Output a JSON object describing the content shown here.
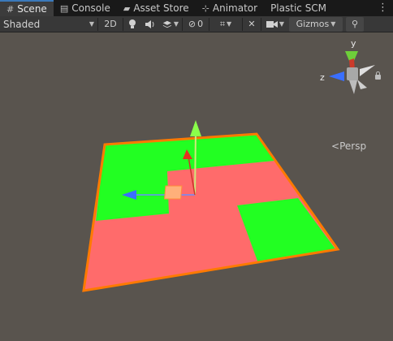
{
  "tabs": [
    {
      "label": "Scene",
      "icon": "grid-icon",
      "active": true
    },
    {
      "label": "Console",
      "icon": "console-icon",
      "active": false
    },
    {
      "label": "Asset Store",
      "icon": "bag-icon",
      "active": false
    },
    {
      "label": "Animator",
      "icon": "animator-icon",
      "active": false
    },
    {
      "label": "Plastic SCM",
      "icon": "",
      "active": false
    }
  ],
  "toolbar": {
    "shading_mode": "Shaded",
    "mode_2d": "2D",
    "hidden_count": "0",
    "gizmos": "Gizmos"
  },
  "gizmo": {
    "y_label": "y",
    "z_label": "z",
    "persp_label": "Persp"
  },
  "colors": {
    "plane_red": "#ff6b6b",
    "plane_green": "#22ff22",
    "outline": "#ff7a00",
    "axis_up": "#8aff4a",
    "axis_forward": "#3a6fff",
    "axis_x": "#e53020"
  }
}
